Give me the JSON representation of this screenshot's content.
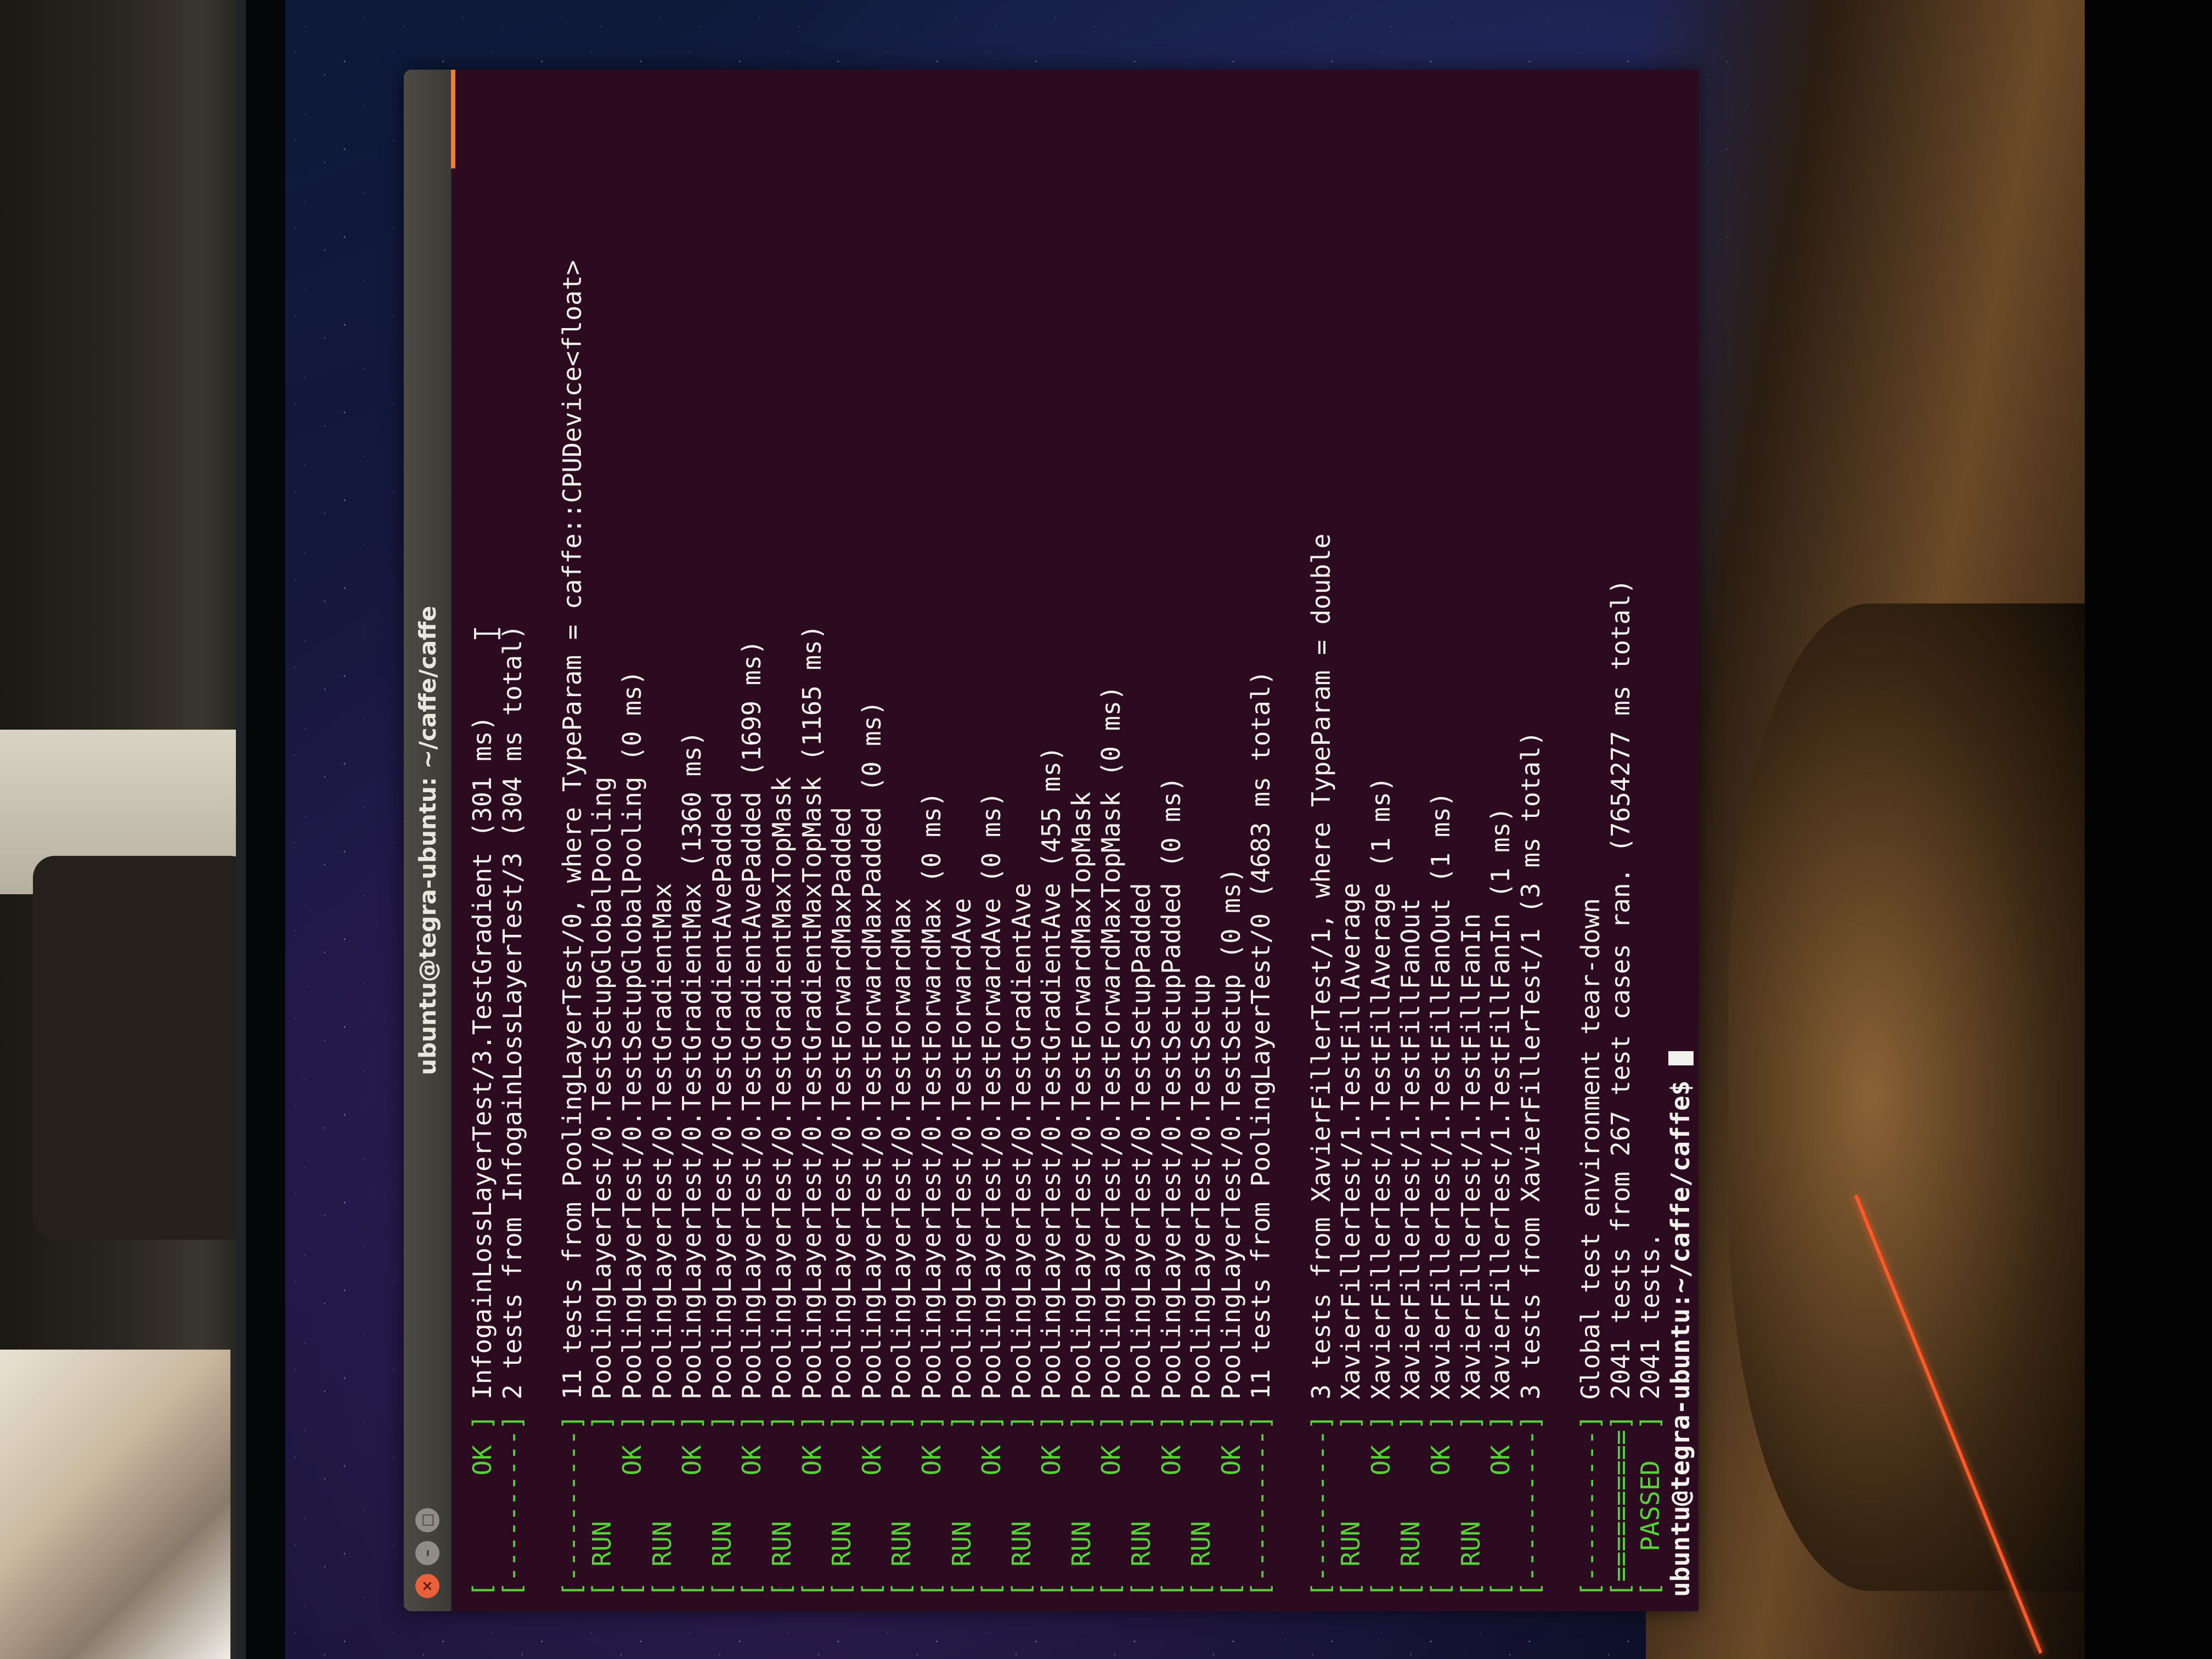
{
  "window": {
    "title": "ubuntu@tegra-ubuntu: ~/caffe/caffe",
    "close_icon": "close-icon",
    "minimize_icon": "minimize-icon",
    "maximize_icon": "maximize-icon",
    "accent_color": "#f07a3a",
    "background_color": "#2c0a1f"
  },
  "terminal": {
    "tag_color": "#55d336",
    "lines": [
      {
        "tag": "[       OK ]",
        "text": " InfogainLossLayerTest/3.TestGradient (301 ms)"
      },
      {
        "tag": "[----------]",
        "text": " 2 tests from InfogainLossLayerTest/3 (304 ms total)"
      },
      {
        "tag": "",
        "text": ""
      },
      {
        "tag": "[----------]",
        "text": " 11 tests from PoolingLayerTest/0, where TypeParam = caffe::CPUDevice<float>"
      },
      {
        "tag": "[ RUN      ]",
        "text": " PoolingLayerTest/0.TestSetupGlobalPooling"
      },
      {
        "tag": "[       OK ]",
        "text": " PoolingLayerTest/0.TestSetupGlobalPooling (0 ms)"
      },
      {
        "tag": "[ RUN      ]",
        "text": " PoolingLayerTest/0.TestGradientMax"
      },
      {
        "tag": "[       OK ]",
        "text": " PoolingLayerTest/0.TestGradientMax (1360 ms)"
      },
      {
        "tag": "[ RUN      ]",
        "text": " PoolingLayerTest/0.TestGradientAvePadded"
      },
      {
        "tag": "[       OK ]",
        "text": " PoolingLayerTest/0.TestGradientAvePadded (1699 ms)"
      },
      {
        "tag": "[ RUN      ]",
        "text": " PoolingLayerTest/0.TestGradientMaxTopMask"
      },
      {
        "tag": "[       OK ]",
        "text": " PoolingLayerTest/0.TestGradientMaxTopMask (1165 ms)"
      },
      {
        "tag": "[ RUN      ]",
        "text": " PoolingLayerTest/0.TestForwardMaxPadded"
      },
      {
        "tag": "[       OK ]",
        "text": " PoolingLayerTest/0.TestForwardMaxPadded (0 ms)"
      },
      {
        "tag": "[ RUN      ]",
        "text": " PoolingLayerTest/0.TestForwardMax"
      },
      {
        "tag": "[       OK ]",
        "text": " PoolingLayerTest/0.TestForwardMax (0 ms)"
      },
      {
        "tag": "[ RUN      ]",
        "text": " PoolingLayerTest/0.TestForwardAve"
      },
      {
        "tag": "[       OK ]",
        "text": " PoolingLayerTest/0.TestForwardAve (0 ms)"
      },
      {
        "tag": "[ RUN      ]",
        "text": " PoolingLayerTest/0.TestGradientAve"
      },
      {
        "tag": "[       OK ]",
        "text": " PoolingLayerTest/0.TestGradientAve (455 ms)"
      },
      {
        "tag": "[ RUN      ]",
        "text": " PoolingLayerTest/0.TestForwardMaxTopMask"
      },
      {
        "tag": "[       OK ]",
        "text": " PoolingLayerTest/0.TestForwardMaxTopMask (0 ms)"
      },
      {
        "tag": "[ RUN      ]",
        "text": " PoolingLayerTest/0.TestSetupPadded"
      },
      {
        "tag": "[       OK ]",
        "text": " PoolingLayerTest/0.TestSetupPadded (0 ms)"
      },
      {
        "tag": "[ RUN      ]",
        "text": " PoolingLayerTest/0.TestSetup"
      },
      {
        "tag": "[       OK ]",
        "text": " PoolingLayerTest/0.TestSetup (0 ms)"
      },
      {
        "tag": "[----------]",
        "text": " 11 tests from PoolingLayerTest/0 (4683 ms total)"
      },
      {
        "tag": "",
        "text": ""
      },
      {
        "tag": "[----------]",
        "text": " 3 tests from XavierFillerTest/1, where TypeParam = double"
      },
      {
        "tag": "[ RUN      ]",
        "text": " XavierFillerTest/1.TestFillAverage"
      },
      {
        "tag": "[       OK ]",
        "text": " XavierFillerTest/1.TestFillAverage (1 ms)"
      },
      {
        "tag": "[ RUN      ]",
        "text": " XavierFillerTest/1.TestFillFanOut"
      },
      {
        "tag": "[       OK ]",
        "text": " XavierFillerTest/1.TestFillFanOut (1 ms)"
      },
      {
        "tag": "[ RUN      ]",
        "text": " XavierFillerTest/1.TestFillFanIn"
      },
      {
        "tag": "[       OK ]",
        "text": " XavierFillerTest/1.TestFillFanIn (1 ms)"
      },
      {
        "tag": "[----------]",
        "text": " 3 tests from XavierFillerTest/1 (3 ms total)"
      },
      {
        "tag": "",
        "text": ""
      },
      {
        "tag": "[----------]",
        "text": " Global test environment tear-down"
      },
      {
        "tag": "[==========]",
        "text": " 2041 tests from 267 test cases ran. (7654277 ms total)"
      },
      {
        "tag": "[  PASSED  ]",
        "text": " 2041 tests."
      }
    ],
    "prompt": "ubuntu@tegra-ubuntu:~/caffe/caffe$ "
  }
}
